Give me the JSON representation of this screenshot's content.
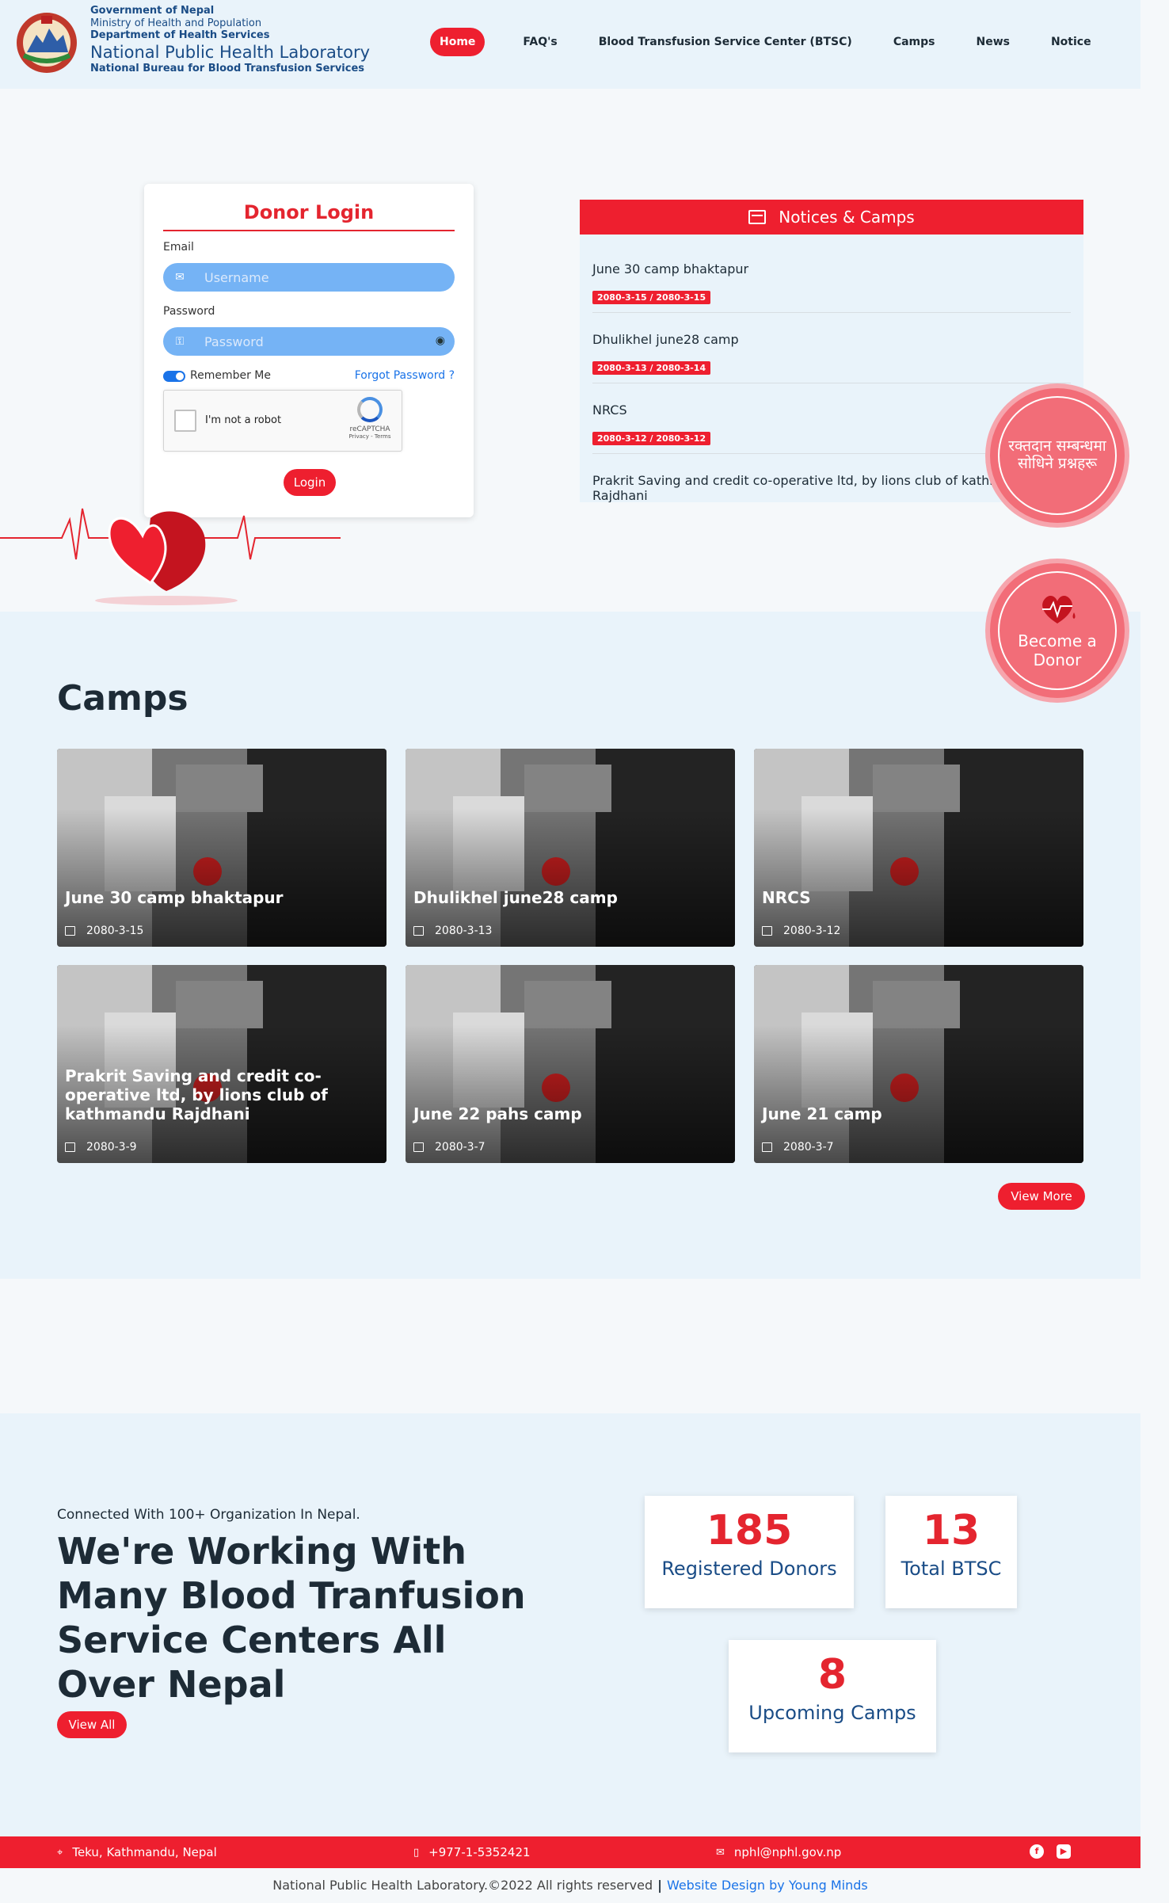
{
  "header": {
    "gov": "Government of Nepal",
    "ministry": "Ministry of Health and Population",
    "department": "Department of Health Services",
    "lab": "National Public Health Laboratory",
    "bureau": "National Bureau for Blood Transfusion Services"
  },
  "nav": [
    "Home",
    "FAQ's",
    "Blood Transfusion Service Center (BTSC)",
    "Camps",
    "News",
    "Notice"
  ],
  "login": {
    "title": "Donor Login",
    "email_label": "Email",
    "username_placeholder": "Username",
    "password_label": "Password",
    "password_placeholder": "Password",
    "remember": "Remember Me",
    "forgot": "Forgot Password ?",
    "captcha_text": "I'm not a robot",
    "captcha_brand": "reCAPTCHA",
    "captcha_links": "Privacy - Terms",
    "button": "Login"
  },
  "notices": {
    "title": "Notices & Camps",
    "items": [
      {
        "title": "June 30 camp bhaktapur",
        "date": "2080-3-15 / 2080-3-15"
      },
      {
        "title": "Dhulikhel june28 camp",
        "date": "2080-3-13 / 2080-3-14"
      },
      {
        "title": "NRCS",
        "date": "2080-3-12 / 2080-3-12"
      },
      {
        "title": "Prakrit Saving and credit co-operative ltd, by lions club of kathmandu Rajdhani",
        "date": ""
      }
    ]
  },
  "floating": {
    "faq_nepali": "रक्तदान सम्बन्धमा सोधिने प्रश्नहरू",
    "donor": "Become a Donor"
  },
  "camps": {
    "title": "Camps",
    "items": [
      {
        "title": "June 30 camp bhaktapur",
        "date": "2080-3-15"
      },
      {
        "title": "Dhulikhel june28 camp",
        "date": "2080-3-13"
      },
      {
        "title": "NRCS",
        "date": "2080-3-12"
      },
      {
        "title": "Prakrit Saving and credit co-operative ltd, by lions club of kathmandu Rajdhani",
        "date": "2080-3-9"
      },
      {
        "title": "June 22 pahs camp",
        "date": "2080-3-7"
      },
      {
        "title": "June 21 camp",
        "date": "2080-3-7"
      }
    ],
    "view_more": "View More"
  },
  "stats": {
    "kicker": "Connected With 100+ Organization In Nepal.",
    "headline": "We're Working With Many Blood Tranfusion Service Centers All Over Nepal",
    "view_all": "View All",
    "registered": {
      "value": "185",
      "label": "Registered Donors"
    },
    "btsc": {
      "value": "13",
      "label": "Total BTSC"
    },
    "upcoming": {
      "value": "8",
      "label": "Upcoming Camps"
    }
  },
  "footer": {
    "address": "Teku, Kathmandu, Nepal",
    "phone": "+977-1-5352421",
    "email": "nphl@nphl.gov.np",
    "copyright": "National Public Health Laboratory.©2022 All rights reserved",
    "design": "Website Design by Young Minds"
  },
  "colors": {
    "primary": "#ee1f2f",
    "navy": "#1a4c86",
    "bg_light": "#e9f3fa"
  }
}
